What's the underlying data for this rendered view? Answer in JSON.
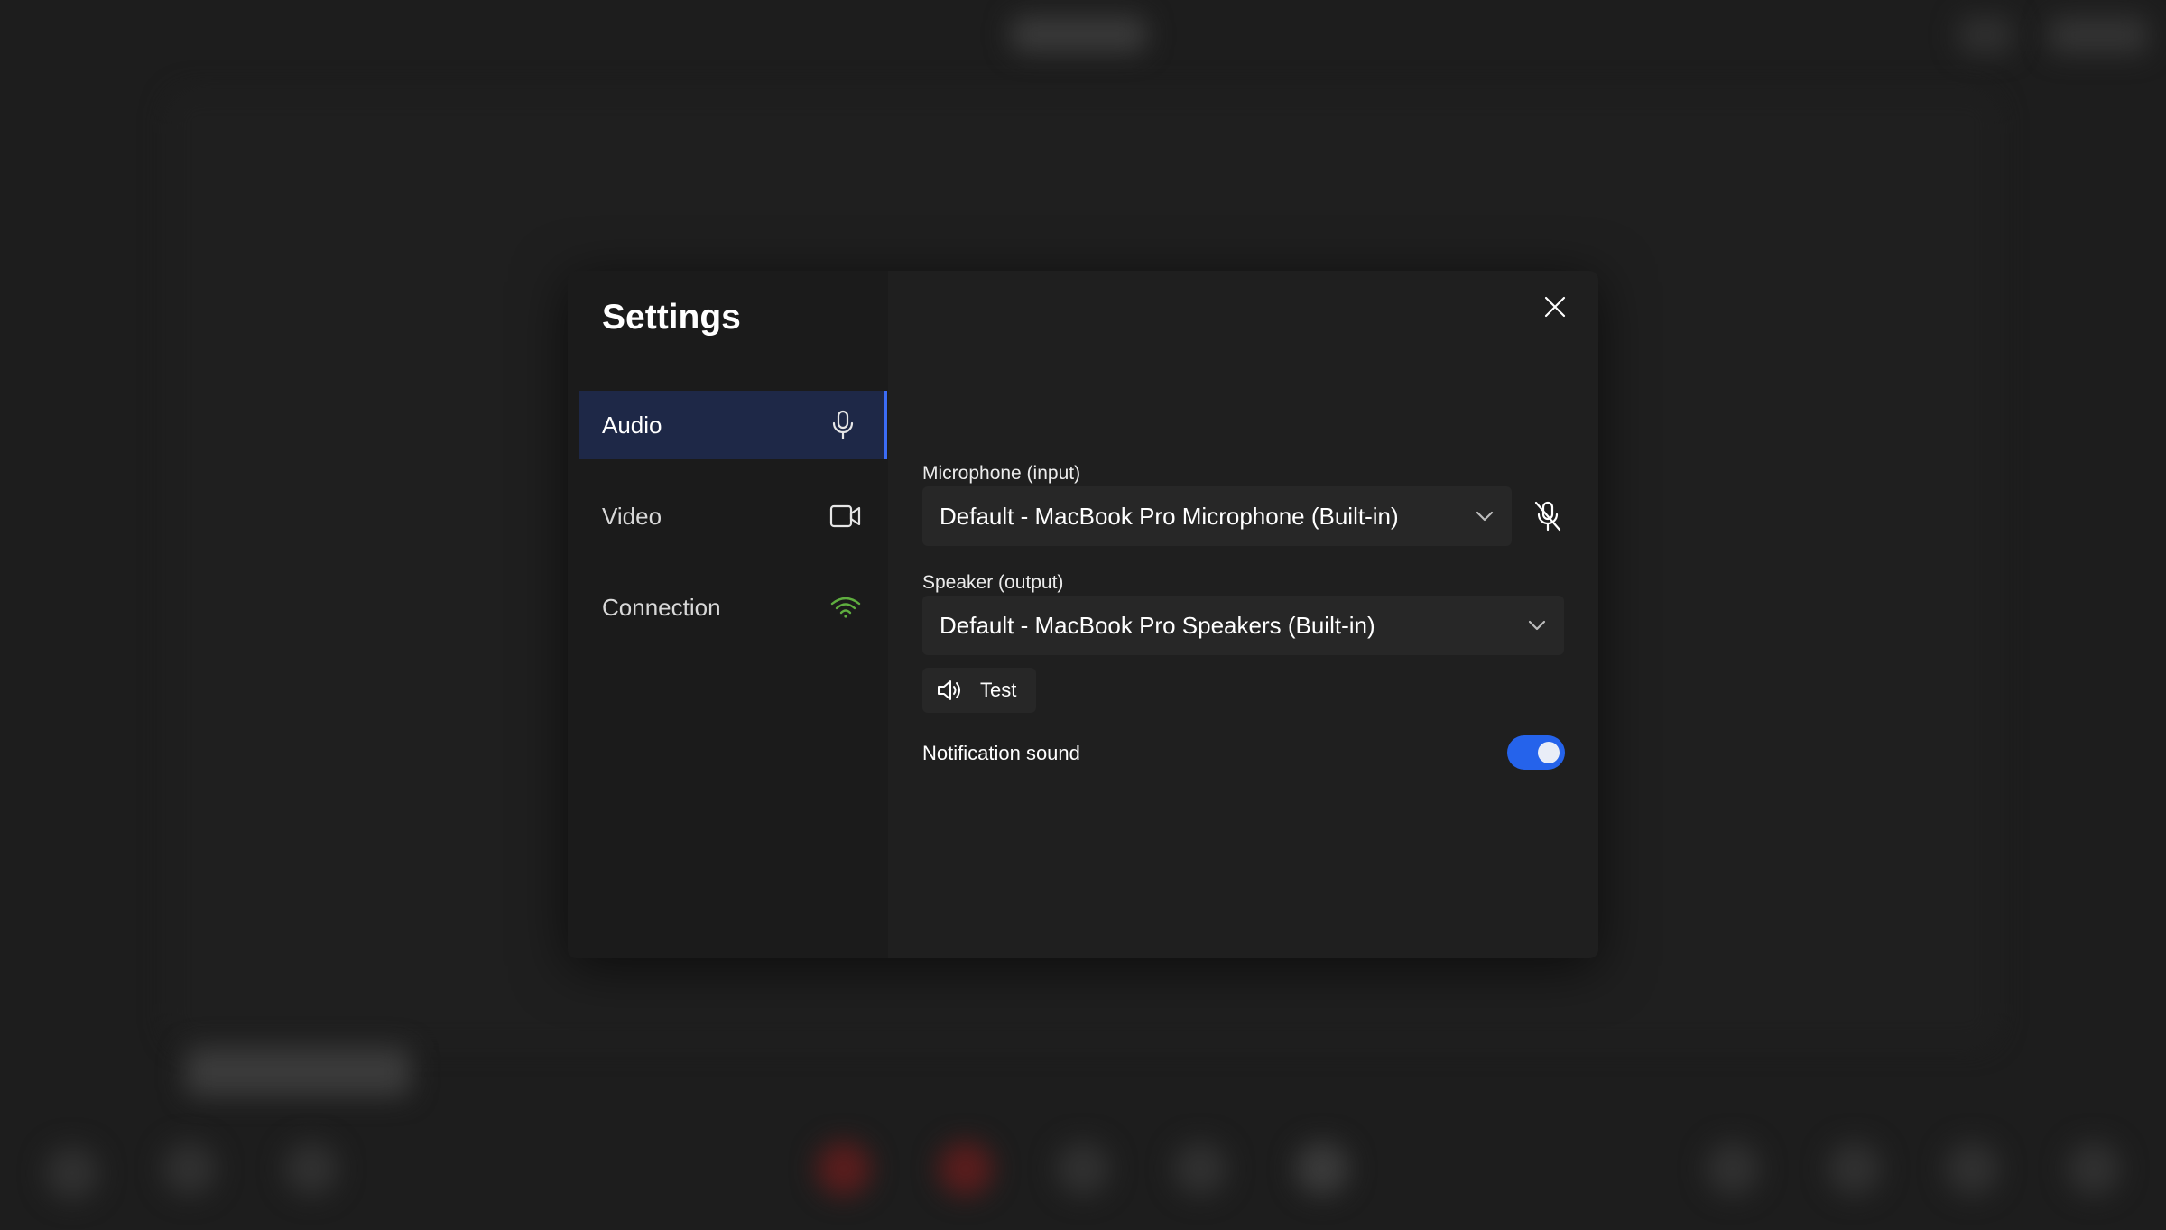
{
  "dialog": {
    "title": "Settings",
    "close_icon": "close-icon"
  },
  "sidebar": {
    "items": [
      {
        "label": "Audio",
        "icon": "microphone-icon",
        "active": true
      },
      {
        "label": "Video",
        "icon": "video-camera-icon",
        "active": false
      },
      {
        "label": "Connection",
        "icon": "wifi-icon",
        "active": false,
        "icon_color": "#5fae3f"
      }
    ]
  },
  "audio": {
    "microphone": {
      "label": "Microphone (input)",
      "value": "Default - MacBook Pro Microphone (Built-in)",
      "mute_icon": "microphone-off-icon"
    },
    "speaker": {
      "label": "Speaker (output)",
      "value": "Default - MacBook Pro Speakers (Built-in)"
    },
    "test_button": {
      "label": "Test",
      "icon": "speaker-icon"
    },
    "notification_sound": {
      "label": "Notification sound",
      "enabled": true
    }
  },
  "colors": {
    "accent": "#2563eb",
    "active_nav_bg": "#1e2847",
    "connection_good": "#5fae3f"
  }
}
